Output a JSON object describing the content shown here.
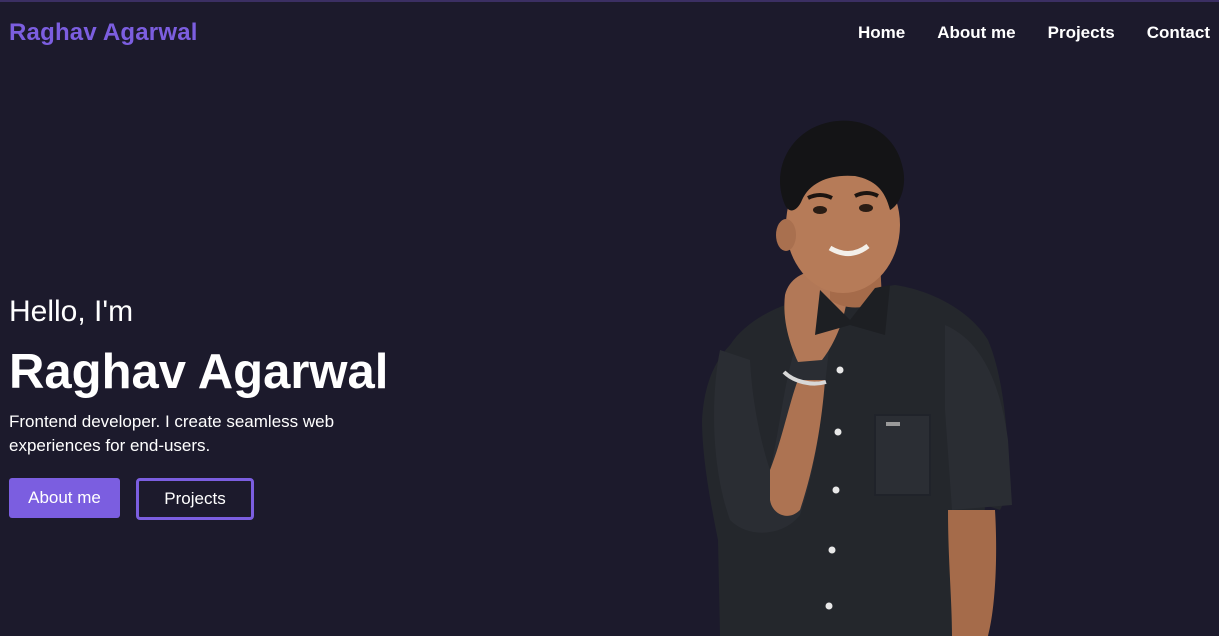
{
  "header": {
    "brand": "Raghav Agarwal",
    "nav": [
      {
        "label": "Home"
      },
      {
        "label": "About me"
      },
      {
        "label": "Projects"
      },
      {
        "label": "Contact"
      }
    ]
  },
  "hero": {
    "greeting": "Hello, I'm",
    "name": "Raghav Agarwal",
    "description": "Frontend developer. I create seamless web experiences for end-users.",
    "primary_button": "About me",
    "secondary_button": "Projects"
  },
  "colors": {
    "background": "#1c1a2c",
    "accent": "#7b5ee0",
    "text": "#ffffff"
  },
  "image": {
    "subject": "portrait-photo"
  }
}
